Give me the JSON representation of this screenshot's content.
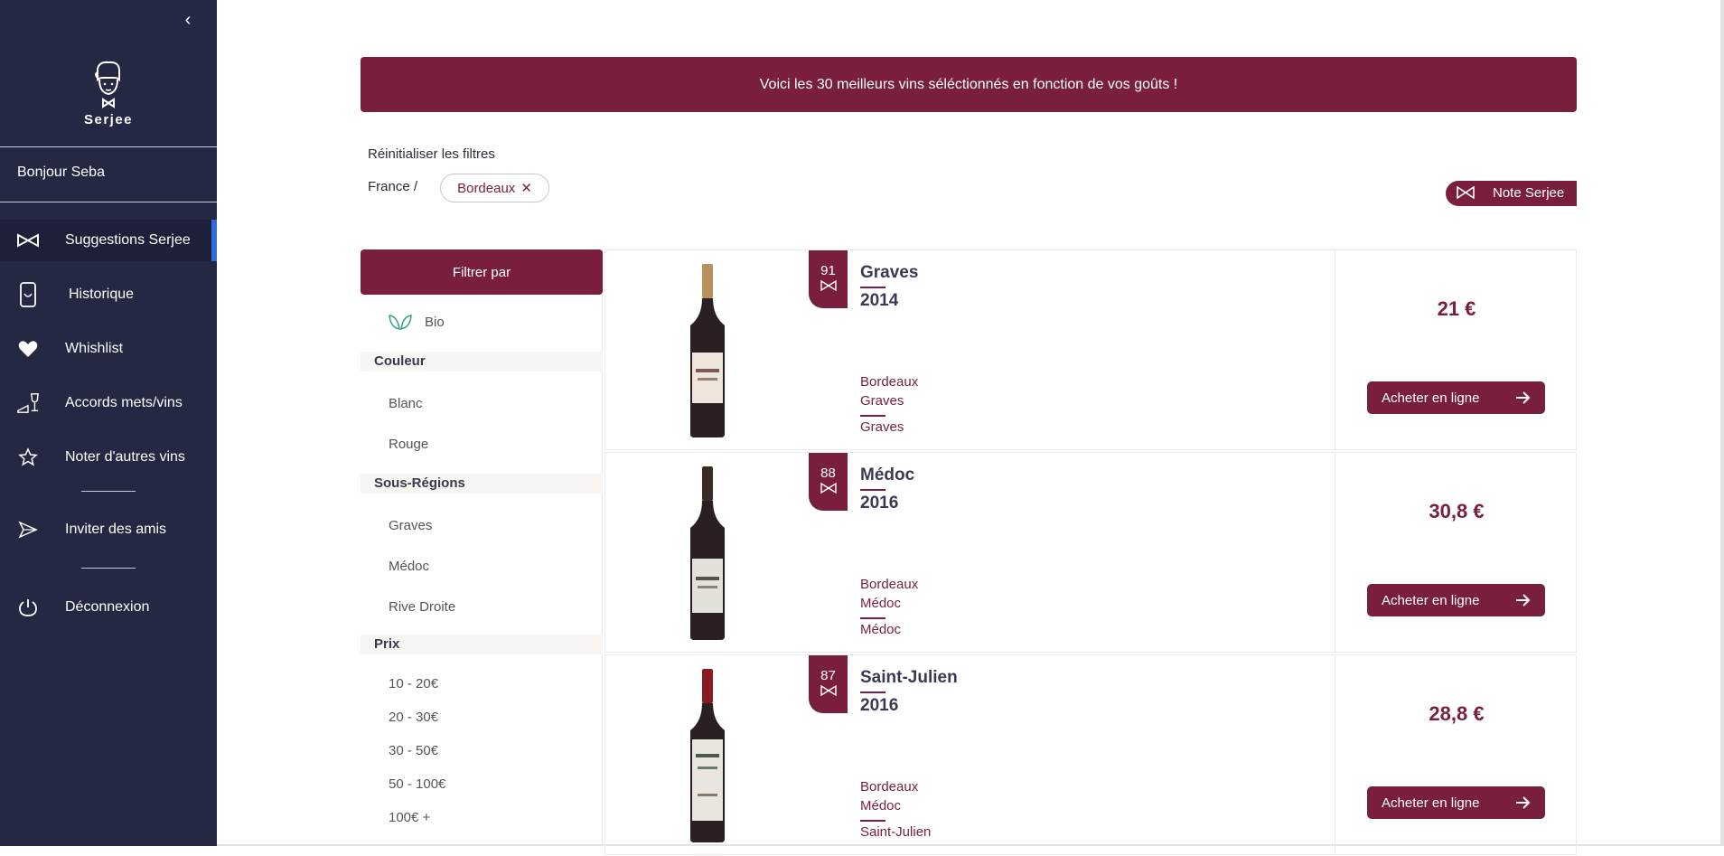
{
  "sidebar": {
    "collapse_icon": "chevron-left-icon",
    "logo_text": "Serjee",
    "greeting": "Bonjour Seba",
    "items": [
      {
        "label": "Suggestions Serjee",
        "icon": "bowtie-icon",
        "active": true
      },
      {
        "label": "Historique",
        "icon": "glass-icon"
      },
      {
        "label": "Whishlist",
        "icon": "heart-icon"
      },
      {
        "label": "Accords mets/vins",
        "icon": "food-wine-icon"
      },
      {
        "label": "Noter d'autres vins",
        "icon": "star-icon"
      },
      {
        "label": "Inviter des amis",
        "icon": "send-icon"
      },
      {
        "label": "Déconnexion",
        "icon": "power-icon"
      }
    ]
  },
  "banner": "Voici les 30 meilleurs vins séléctionnés en fonction de vos goûts !",
  "filters_bar": {
    "reset": "Réinitialiser les filtres",
    "crumb": "France /",
    "chip": "Bordeaux",
    "note_button": "Note Serjee"
  },
  "filter_panel": {
    "title": "Filtrer par",
    "bio": "Bio",
    "sections": {
      "couleur": {
        "title": "Couleur",
        "options": [
          "Blanc",
          "Rouge"
        ]
      },
      "sous_regions": {
        "title": "Sous-Régions",
        "options": [
          "Graves",
          "Médoc",
          "Rive Droite"
        ]
      },
      "prix": {
        "title": "Prix",
        "options": [
          "10 - 20€",
          "20 - 30€",
          "30 - 50€",
          "50 - 100€",
          "100€ +"
        ]
      }
    }
  },
  "wines": [
    {
      "score": "91",
      "name": "Graves",
      "year": "2014",
      "region": "Bordeaux",
      "subregion": "Graves",
      "appellation": "Graves",
      "price": "21 €",
      "buy": "Acheter en ligne"
    },
    {
      "score": "88",
      "name": "Médoc",
      "year": "2016",
      "region": "Bordeaux",
      "subregion": "Médoc",
      "appellation": "Médoc",
      "price": "30,8 €",
      "buy": "Acheter en ligne"
    },
    {
      "score": "87",
      "name": "Saint-Julien",
      "year": "2016",
      "region": "Bordeaux",
      "subregion": "Médoc",
      "appellation": "Saint-Julien",
      "price": "28,8 €",
      "buy": "Acheter en ligne"
    }
  ],
  "colors": {
    "sidebar": "#252842",
    "accent": "#7a1e3e",
    "active_marker": "#2f6ed6"
  }
}
